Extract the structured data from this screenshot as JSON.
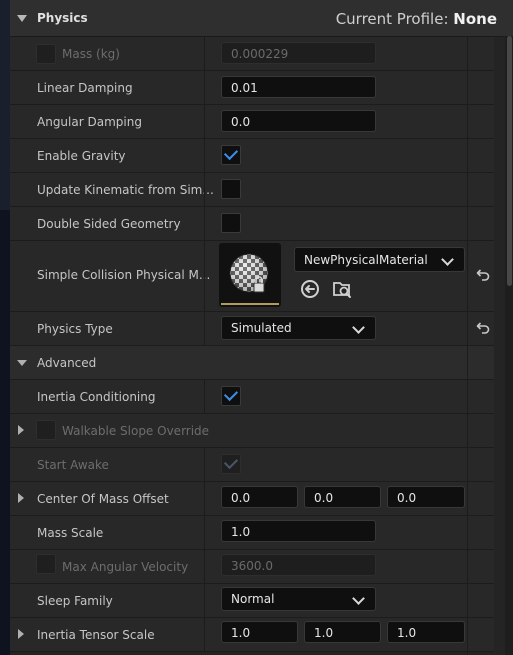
{
  "header": {
    "title": "Physics",
    "profile_prefix": "Current Profile: ",
    "profile_value": "None"
  },
  "rows": {
    "mass": {
      "label": "Mass (kg)",
      "value": "0.000229"
    },
    "linear_damping": {
      "label": "Linear Damping",
      "value": "0.01"
    },
    "angular_damping": {
      "label": "Angular Damping",
      "value": "0.0"
    },
    "enable_gravity": {
      "label": "Enable Gravity",
      "checked": true
    },
    "update_kinematic": {
      "label": "Update Kinematic from Sim...",
      "checked": false
    },
    "double_sided": {
      "label": "Double Sided Geometry",
      "checked": false
    },
    "simple_collision": {
      "label": "Simple Collision Physical M...",
      "value": "NewPhysicalMaterial"
    },
    "physics_type": {
      "label": "Physics Type",
      "value": "Simulated"
    }
  },
  "advanced": {
    "label": "Advanced",
    "inertia_conditioning": {
      "label": "Inertia Conditioning",
      "checked": true
    },
    "walkable_slope": {
      "label": "Walkable Slope Override"
    },
    "start_awake": {
      "label": "Start Awake",
      "checked": true
    },
    "center_of_mass": {
      "label": "Center Of Mass Offset",
      "x": "0.0",
      "y": "0.0",
      "z": "0.0"
    },
    "mass_scale": {
      "label": "Mass Scale",
      "value": "1.0"
    },
    "max_angular_velocity": {
      "label": "Max Angular Velocity",
      "value": "3600.0"
    },
    "sleep_family": {
      "label": "Sleep Family",
      "value": "Normal"
    },
    "inertia_tensor_scale": {
      "label": "Inertia Tensor Scale",
      "x": "1.0",
      "y": "1.0",
      "z": "1.0"
    }
  },
  "colors": {
    "accent_check": "#3d8ee6",
    "thumb_underline": "#b39a5a"
  },
  "icons": [
    "collapse-arrow-icon",
    "reset-arrow-icon",
    "chevron-down-icon",
    "use-selected-icon",
    "browse-icon",
    "checkmark-icon",
    "expand-arrow-icon"
  ]
}
